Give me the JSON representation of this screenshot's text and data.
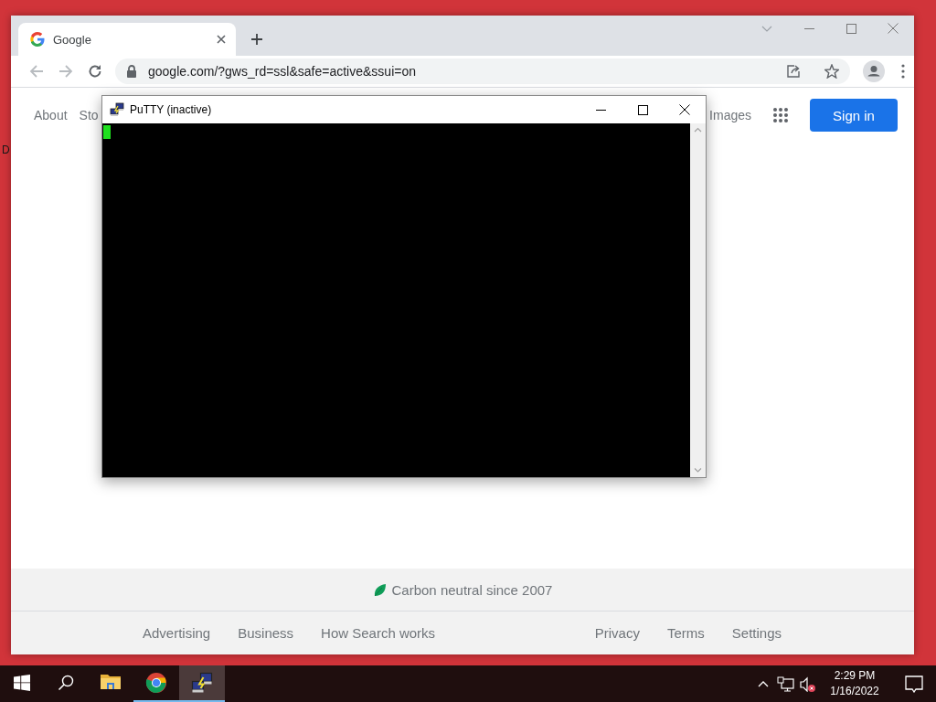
{
  "desktop": {
    "icon_label": "D"
  },
  "browser": {
    "tabs": [
      {
        "label": "Google",
        "selected": true
      }
    ],
    "address": "google.com/?gws_rd=ssl&safe=active&ssui=on",
    "nav_left": [
      "About",
      "Sto"
    ],
    "nav_right": [
      "Images"
    ],
    "sign_in": "Sign in",
    "footer": {
      "carbon": "Carbon neutral since 2007",
      "links_left": [
        "Advertising",
        "Business",
        "How Search works"
      ],
      "links_right": [
        "Privacy",
        "Terms",
        "Settings"
      ]
    }
  },
  "putty": {
    "title": "PuTTY (inactive)"
  },
  "taskbar": {
    "apps": [
      {
        "kind": "explorer",
        "selected": false,
        "running": false
      },
      {
        "kind": "chrome",
        "selected": false,
        "running": true
      },
      {
        "kind": "putty",
        "selected": true,
        "running": true
      }
    ],
    "time": "2:29 PM",
    "date": "1/16/2022"
  }
}
